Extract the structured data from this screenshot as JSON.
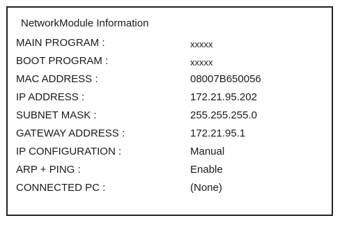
{
  "panel": {
    "title": "NetworkModule Information",
    "rows": [
      {
        "label": "MAIN PROGRAM :",
        "value": "xxxxx"
      },
      {
        "label": "BOOT PROGRAM :",
        "value": "xxxxx"
      },
      {
        "label": "MAC ADDRESS :",
        "value": "08007B650056"
      },
      {
        "label": "IP ADDRESS :",
        "value": "172.21.95.202"
      },
      {
        "label": "SUBNET MASK :",
        "value": "255.255.255.0"
      },
      {
        "label": "GATEWAY ADDRESS :",
        "value": "172.21.95.1"
      },
      {
        "label": "IP CONFIGURATION :",
        "value": "Manual"
      },
      {
        "label": "ARP + PING :",
        "value": "Enable"
      },
      {
        "label": "CONNECTED PC :",
        "value": "(None)"
      }
    ]
  }
}
